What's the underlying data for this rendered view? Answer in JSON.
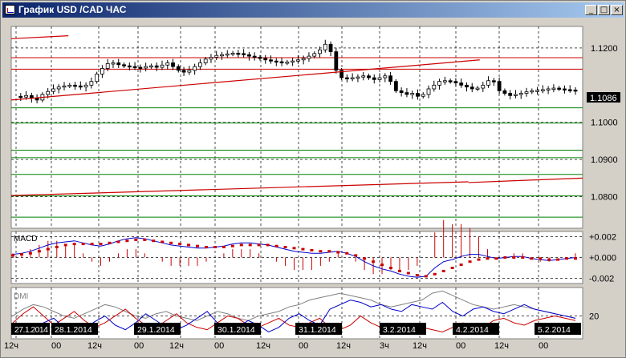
{
  "window": {
    "title": "График USD /CAD  ЧАС",
    "buttons": {
      "minimize": "_",
      "maximize": "□",
      "close": "×"
    }
  },
  "colors": {
    "panel_bg": "#ffffff",
    "grid": "#000000",
    "candle": "#000000",
    "trend": "#cc0000",
    "resistance": "#cc0000",
    "support": "#008000",
    "macd_line": "#0000cc",
    "signal": "#cc0000",
    "dmi_plus": "#0000cc",
    "dmi_minus": "#cc0000",
    "adx": "#808080"
  },
  "price_panel": {
    "current_price": "1.1086",
    "y_ticks": [
      "1.1200",
      "1.1000",
      "1.0900",
      "1.0800"
    ],
    "resistance_levels": [
      1.1174,
      1.1143
    ],
    "support_levels": [
      1.1039,
      1.0998,
      1.0925,
      1.0905,
      1.086,
      1.0802,
      1.0745
    ]
  },
  "macd_panel": {
    "label": "MACD",
    "y_ticks": [
      "+0.002",
      "+0.000",
      "-0.002"
    ]
  },
  "dmi_panel": {
    "label": "DMI",
    "y_ticks": [
      "20"
    ]
  },
  "date_labels": [
    "27.1.2014",
    "28.1.2014",
    "29.1.2014",
    "30.1.2014",
    "31.1.2014",
    "3.2.2014",
    "4.2.2014",
    "5.2.2014"
  ],
  "time_labels": [
    "12ч",
    "00",
    "12ч",
    "00",
    "12ч",
    "00",
    "12ч",
    "00",
    "12ч",
    "3ч",
    "12ч",
    "00",
    "12ч",
    "00"
  ],
  "chart_data": {
    "type": "candlestick",
    "title": "График USD /CAD  ЧАС",
    "x_days": [
      "27.1.2014",
      "28.1.2014",
      "29.1.2014",
      "30.1.2014",
      "31.1.2014",
      "3.2.2014",
      "4.2.2014",
      "5.2.2014"
    ],
    "ylim": [
      1.0715,
      1.1258
    ],
    "close_path": [
      1.107,
      1.1068,
      1.1072,
      1.1065,
      1.106,
      1.1075,
      1.1083,
      1.109,
      1.1095,
      1.1098,
      1.11,
      1.1098,
      1.1095,
      1.11,
      1.111,
      1.113,
      1.1145,
      1.1158,
      1.116,
      1.1155,
      1.1152,
      1.115,
      1.1148,
      1.1146,
      1.115,
      1.1152,
      1.1148,
      1.1154,
      1.116,
      1.115,
      1.114,
      1.1135,
      1.114,
      1.115,
      1.116,
      1.117,
      1.1175,
      1.118,
      1.1182,
      1.1184,
      1.1186,
      1.1185,
      1.1182,
      1.1178,
      1.1175,
      1.1172,
      1.1168,
      1.1165,
      1.1163,
      1.116,
      1.1162,
      1.1165,
      1.1168,
      1.1172,
      1.1178,
      1.1185,
      1.1195,
      1.121,
      1.119,
      1.114,
      1.112,
      1.1118,
      1.112,
      1.1122,
      1.1125,
      1.112,
      1.1115,
      1.112,
      1.1125,
      1.111,
      1.1085,
      1.108,
      1.1075,
      1.1078,
      1.107,
      1.1075,
      1.109,
      1.11,
      1.111,
      1.1112,
      1.111,
      1.1106,
      1.11,
      1.1095,
      1.109,
      1.1092,
      1.11,
      1.1112,
      1.111,
      1.1085,
      1.1078,
      1.1072,
      1.1075,
      1.1078,
      1.1082,
      1.1085,
      1.1086,
      1.1088,
      1.109,
      1.1092,
      1.109,
      1.1088,
      1.1087,
      1.1086
    ],
    "trend_lines": [
      {
        "x": [
          0.0,
          0.1
        ],
        "y": [
          1.1225,
          1.1233
        ]
      },
      {
        "x": [
          0.0,
          0.82
        ],
        "y": [
          1.106,
          1.1168
        ]
      },
      {
        "x": [
          0.0,
          0.8
        ],
        "y": [
          1.0803,
          1.084
        ]
      },
      {
        "x": [
          0.8,
          1.0
        ],
        "y": [
          1.0838,
          1.085
        ]
      }
    ],
    "macd_ylim": [
      -0.0025,
      0.0025
    ],
    "macd": [
      0.0003,
      0.0004,
      0.0006,
      0.0009,
      0.0012,
      0.0014,
      0.0015,
      0.0016,
      0.0014,
      0.0012,
      0.0011,
      0.0013,
      0.0016,
      0.0018,
      0.0019,
      0.0018,
      0.0016,
      0.0014,
      0.0012,
      0.0011,
      0.001,
      0.0009,
      0.0009,
      0.001,
      0.0011,
      0.0013,
      0.0014,
      0.0014,
      0.0013,
      0.0012,
      0.001,
      0.0008,
      0.0006,
      0.0005,
      0.0004,
      0.0004,
      0.0005,
      0.0006,
      0.0004,
      0.0001,
      -0.0004,
      -0.0008,
      -0.0011,
      -0.0013,
      -0.0016,
      -0.0018,
      -0.0019,
      -0.0018,
      -0.001,
      -0.0004,
      -0.0002,
      0.0001,
      0.0003,
      0.0003,
      0.0001,
      -0.0001,
      0.0,
      0.0001,
      0.0001,
      -0.0001,
      -0.0002,
      -0.0003,
      -0.0002,
      -0.0001,
      0.0
    ],
    "signal": [
      0.0002,
      0.0003,
      0.0004,
      0.0006,
      0.0008,
      0.001,
      0.0012,
      0.0013,
      0.0013,
      0.0013,
      0.0013,
      0.0014,
      0.0015,
      0.0016,
      0.0017,
      0.0017,
      0.0016,
      0.0015,
      0.0014,
      0.0013,
      0.0012,
      0.0011,
      0.001,
      0.001,
      0.001,
      0.0011,
      0.0012,
      0.0012,
      0.0012,
      0.0012,
      0.0011,
      0.001,
      0.0009,
      0.0008,
      0.0007,
      0.0006,
      0.0006,
      0.0005,
      0.0004,
      0.0002,
      -0.0001,
      -0.0004,
      -0.0007,
      -0.001,
      -0.0013,
      -0.0015,
      -0.0017,
      -0.0018,
      -0.0016,
      -0.0013,
      -0.001,
      -0.0007,
      -0.0004,
      -0.0002,
      -0.0001,
      -0.0001,
      0.0,
      0.0,
      0.0,
      -0.0001,
      -0.0001,
      -0.0002,
      -0.0002,
      -0.0001,
      -0.0001
    ],
    "dmi_ylim": [
      0,
      45
    ],
    "dmi_plus": [
      8,
      12,
      6,
      14,
      18,
      10,
      6,
      9,
      15,
      20,
      12,
      8,
      14,
      22,
      16,
      10,
      8,
      12,
      18,
      24,
      14,
      8,
      10,
      16,
      12,
      6,
      10,
      18,
      22,
      16,
      12,
      26,
      30,
      34,
      32,
      28,
      30,
      26,
      24,
      30,
      28,
      26,
      32,
      24,
      20,
      26,
      28,
      24,
      22,
      26,
      30,
      26,
      24,
      22,
      20,
      18
    ],
    "dmi_minus": [
      14,
      22,
      28,
      20,
      12,
      18,
      24,
      16,
      10,
      14,
      20,
      26,
      18,
      12,
      10,
      16,
      22,
      14,
      10,
      8,
      14,
      20,
      18,
      12,
      10,
      14,
      18,
      12,
      10,
      14,
      18,
      10,
      8,
      12,
      20,
      14,
      10,
      8,
      6,
      12,
      10,
      8,
      6,
      10,
      14,
      12,
      10,
      16,
      18,
      14,
      12,
      16,
      18,
      20,
      18,
      16
    ],
    "adx": [
      20,
      26,
      30,
      28,
      24,
      20,
      18,
      22,
      26,
      30,
      28,
      24,
      20,
      18,
      22,
      24,
      20,
      18,
      16,
      20,
      24,
      22,
      18,
      16,
      20,
      22,
      24,
      28,
      30,
      34,
      36,
      38,
      40,
      38,
      36,
      34,
      30,
      28,
      30,
      32,
      34,
      40,
      42,
      38,
      34,
      30,
      28,
      26,
      28,
      30,
      28,
      26,
      24,
      22,
      20,
      18
    ]
  }
}
